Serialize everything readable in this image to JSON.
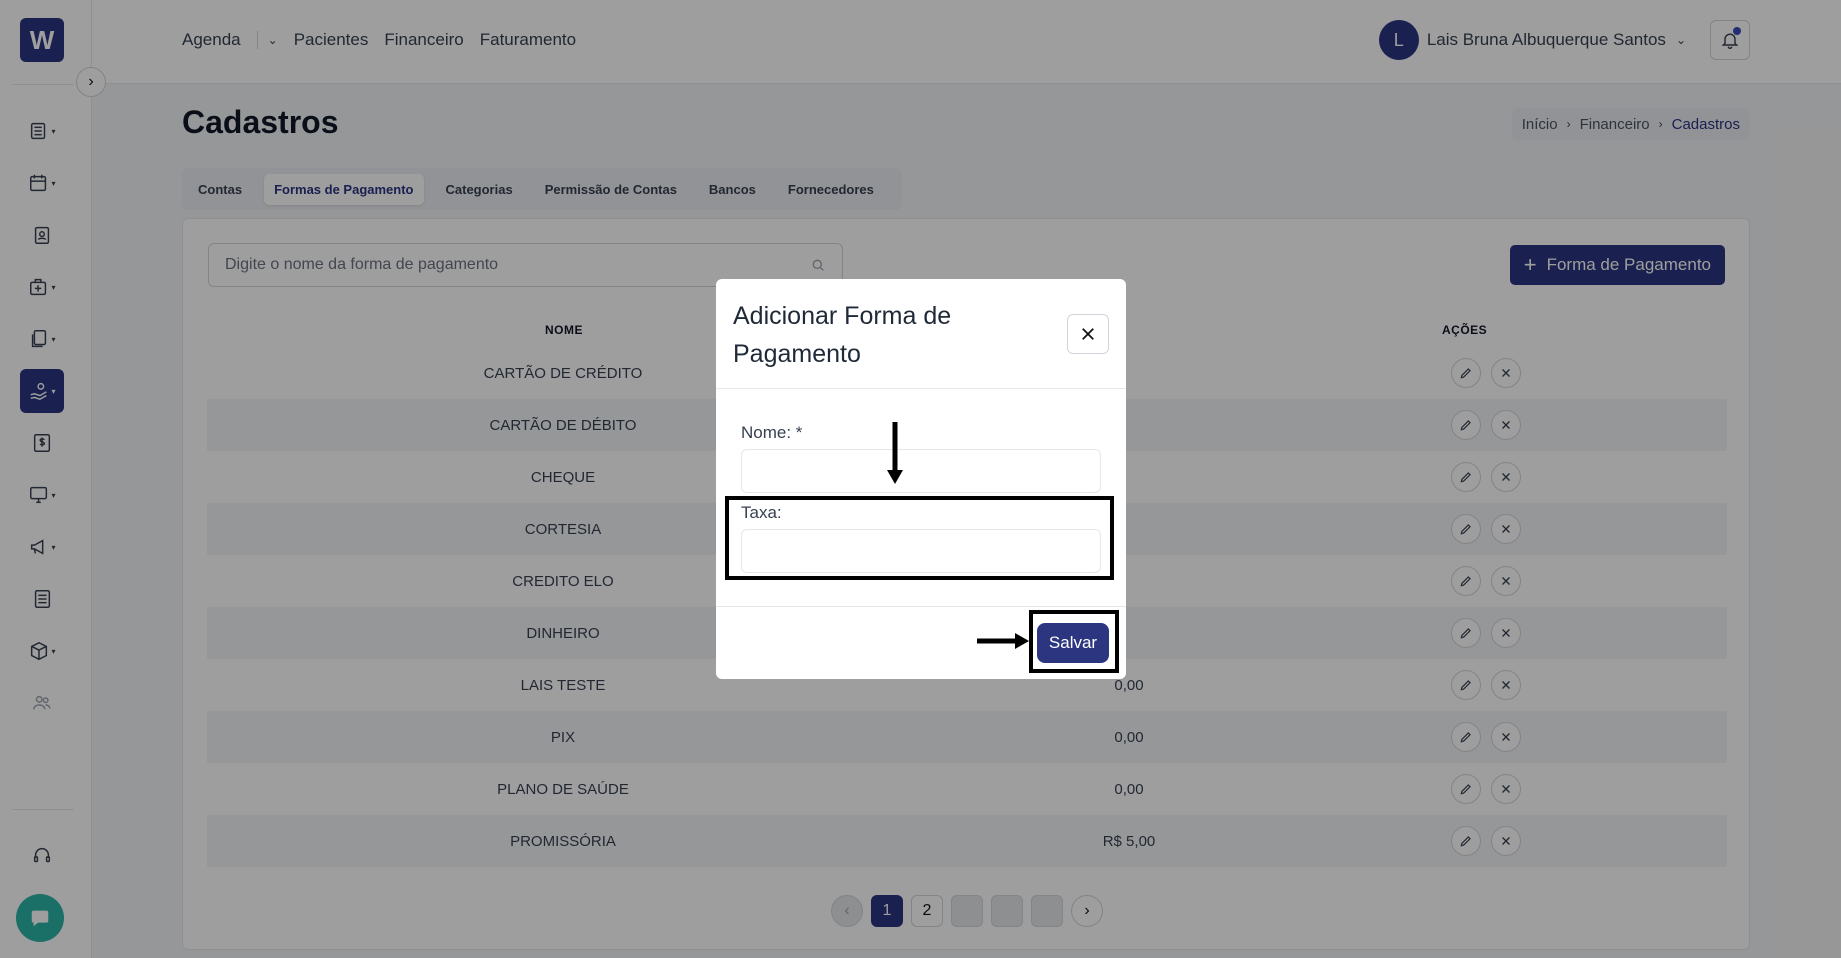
{
  "sidebar": {
    "logo": "W",
    "items": [
      {
        "icon": "list-icon"
      },
      {
        "icon": "calendar-icon"
      },
      {
        "icon": "patient-badge-icon"
      },
      {
        "icon": "medical-kit-icon"
      },
      {
        "icon": "documents-icon"
      },
      {
        "icon": "hand-money-icon",
        "active": true
      },
      {
        "icon": "dollar-sheet-icon"
      },
      {
        "icon": "monitor-icon"
      },
      {
        "icon": "megaphone-icon"
      },
      {
        "icon": "newspaper-icon"
      },
      {
        "icon": "box-icon"
      },
      {
        "icon": "users-icon"
      }
    ],
    "support_icon": "headset-icon",
    "chat_icon": "chat-bubble-icon"
  },
  "topbar": {
    "nav": [
      "Agenda",
      "Pacientes",
      "Financeiro",
      "Faturamento"
    ],
    "user": {
      "initial": "L",
      "name": "Lais Bruna Albuquerque Santos"
    }
  },
  "page": {
    "title": "Cadastros",
    "breadcrumb": [
      "Início",
      "Financeiro",
      "Cadastros"
    ],
    "tabs": [
      "Contas",
      "Formas de Pagamento",
      "Categorias",
      "Permissão de Contas",
      "Bancos",
      "Fornecedores"
    ],
    "active_tab": "Formas de Pagamento"
  },
  "list": {
    "search_placeholder": "Digite o nome da forma de pagamento",
    "add_button": "Forma de Pagamento",
    "headers": {
      "name": "NOME",
      "actions": "AÇÕES"
    },
    "rows": [
      {
        "name": "CARTÃO DE CRÉDITO",
        "tax": ""
      },
      {
        "name": "CARTÃO DE DÉBITO",
        "tax": ""
      },
      {
        "name": "CHEQUE",
        "tax": ""
      },
      {
        "name": "CORTESIA",
        "tax": ""
      },
      {
        "name": "CREDITO ELO",
        "tax": ""
      },
      {
        "name": "DINHEIRO",
        "tax": ""
      },
      {
        "name": "LAIS TESTE",
        "tax": "0,00"
      },
      {
        "name": "PIX",
        "tax": "0,00"
      },
      {
        "name": "PLANO DE SAÚDE",
        "tax": "0,00"
      },
      {
        "name": "PROMISSÓRIA",
        "tax": "R$ 5,00"
      }
    ],
    "pagination": {
      "pages": [
        "1",
        "2"
      ],
      "current": "1"
    }
  },
  "modal": {
    "title": "Adicionar Forma de Pagamento",
    "name_label": "Nome: *",
    "name_value": "",
    "tax_label": "Taxa:",
    "tax_value": "",
    "save_button": "Salvar"
  },
  "colors": {
    "primary": "#2b3580",
    "chat": "#2bb3a6"
  }
}
